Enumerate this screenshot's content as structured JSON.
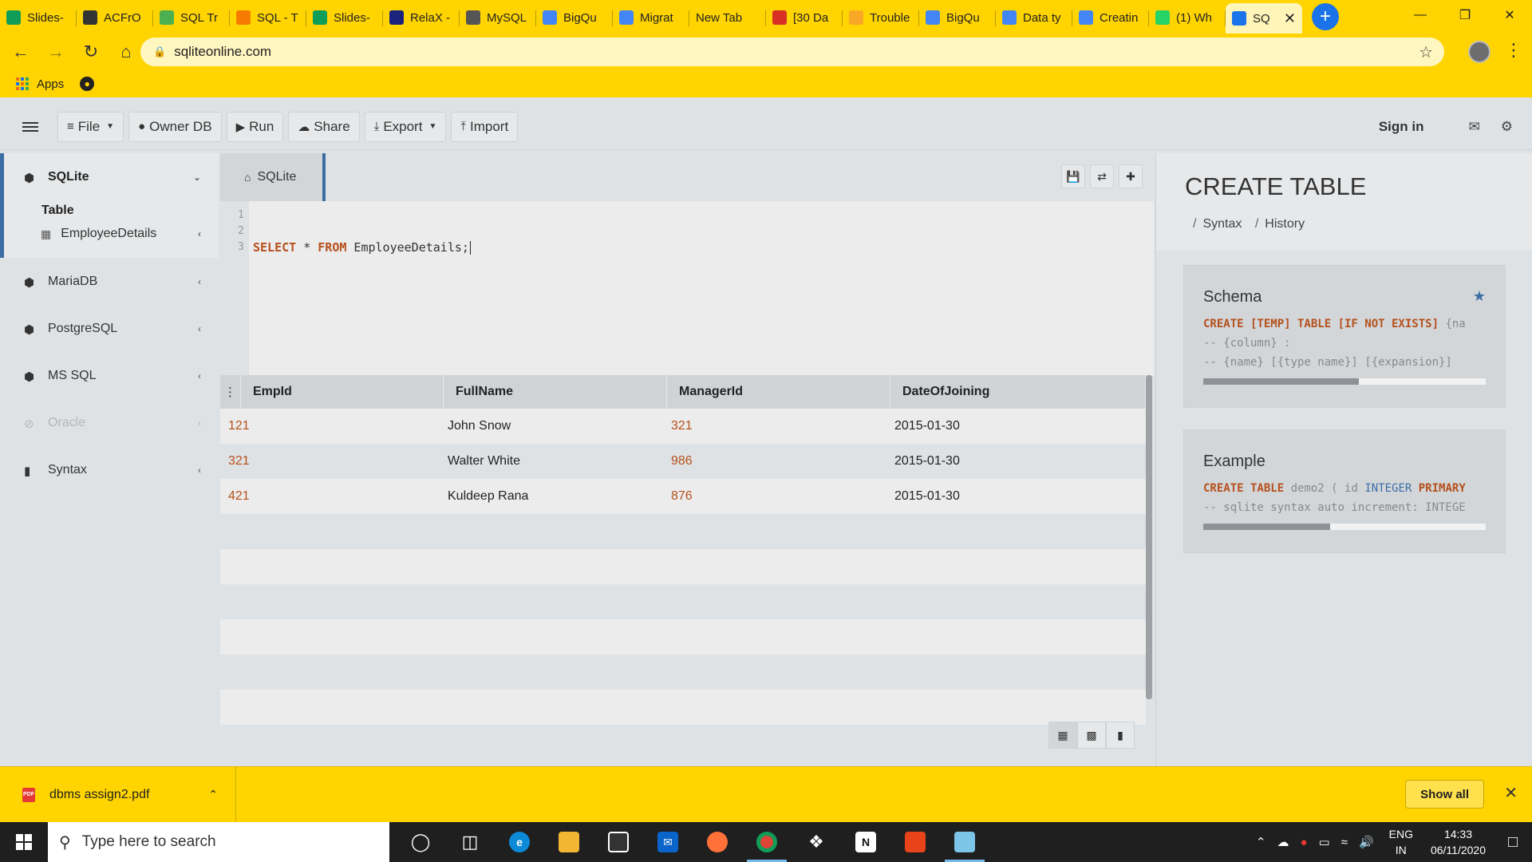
{
  "browser": {
    "tabs": [
      {
        "label": "Slides-",
        "icon": "google-slides-icon",
        "color": "#0f9d58"
      },
      {
        "label": "ACFrO",
        "icon": "globe-icon",
        "color": "#333333"
      },
      {
        "label": "SQL Tr",
        "icon": "w3schools-icon",
        "color": "#4caf50"
      },
      {
        "label": "SQL - T",
        "icon": "blogger-icon",
        "color": "#f57c00"
      },
      {
        "label": "Slides-",
        "icon": "google-slides-icon",
        "color": "#0f9d58"
      },
      {
        "label": "RelaX -",
        "icon": "chart-icon",
        "color": "#1a237e"
      },
      {
        "label": "MySQL",
        "icon": "globe-icon",
        "color": "#555555"
      },
      {
        "label": "BigQu",
        "icon": "google-cloud-icon",
        "color": "#4285f4"
      },
      {
        "label": "Migrat",
        "icon": "google-cloud-icon",
        "color": "#4285f4"
      },
      {
        "label": "New Tab",
        "icon": "",
        "color": ""
      },
      {
        "label": "[30 Da",
        "icon": "gmail-icon",
        "color": "#d93025"
      },
      {
        "label": "Trouble",
        "icon": "stackoverflow-icon",
        "color": "#f9a825"
      },
      {
        "label": "BigQu",
        "icon": "search-icon",
        "color": "#4285f4"
      },
      {
        "label": "Data ty",
        "icon": "google-cloud-icon",
        "color": "#4285f4"
      },
      {
        "label": "Creatin",
        "icon": "google-cloud-icon",
        "color": "#4285f4"
      },
      {
        "label": "(1) Wh",
        "icon": "whatsapp-icon",
        "color": "#25d366"
      },
      {
        "label": "SQ",
        "icon": "sqlite-icon",
        "color": "#1a73e8",
        "active": true
      }
    ],
    "url": "sqliteonline.com",
    "bookmarks": {
      "apps_label": "Apps"
    }
  },
  "app": {
    "toolbar": {
      "file": "File",
      "owner_db": "Owner DB",
      "run": "Run",
      "share": "Share",
      "export": "Export",
      "import": "Import",
      "sign_in": "Sign in"
    },
    "sidebar": {
      "active_db": "SQLite",
      "table_label": "Table",
      "table_item": "EmployeeDetails",
      "databases": [
        "MariaDB",
        "PostgreSQL",
        "MS SQL",
        "Oracle",
        "Syntax"
      ]
    },
    "editor": {
      "tab_label": "SQLite",
      "line_numbers": [
        "1",
        "2",
        "3"
      ],
      "query": {
        "kw_select": "SELECT",
        "star": " * ",
        "kw_from": "FROM",
        "rest": " EmployeeDetails;"
      }
    },
    "results": {
      "columns": [
        "EmpId",
        "FullName",
        "ManagerId",
        "DateOfJoining"
      ],
      "rows": [
        {
          "empid": "121",
          "fullname": "John Snow",
          "managerid": "321",
          "doj": "2015-01-30"
        },
        {
          "empid": "321",
          "fullname": "Walter White",
          "managerid": "986",
          "doj": "2015-01-30"
        },
        {
          "empid": "421",
          "fullname": "Kuldeep Rana",
          "managerid": "876",
          "doj": "2015-01-30"
        }
      ]
    },
    "docs": {
      "title": "CREATE TABLE",
      "crumbs": [
        "Syntax",
        "History"
      ],
      "schema": {
        "title": "Schema",
        "line1_kw": "CREATE [TEMP] TABLE [IF NOT EXISTS]",
        "line1_rest": " {na",
        "line2": "-- {column} :",
        "line3": "-- {name} [{type name}] [{expansion}]",
        "scroll_fraction": 0.55
      },
      "example": {
        "title": "Example",
        "line1_kw": "CREATE TABLE",
        "line1_mid": " demo2 ( id ",
        "line1_type": "INTEGER",
        "line1_end": " PRIMARY",
        "line2": "-- sqlite syntax auto increment: INTEGE",
        "scroll_fraction": 0.45
      }
    }
  },
  "downloads": {
    "file": "dbms assign2.pdf",
    "show_all": "Show all"
  },
  "taskbar": {
    "search_placeholder": "Type here to search",
    "lang1": "ENG",
    "lang2": "IN",
    "time": "14:33",
    "date": "06/11/2020"
  }
}
